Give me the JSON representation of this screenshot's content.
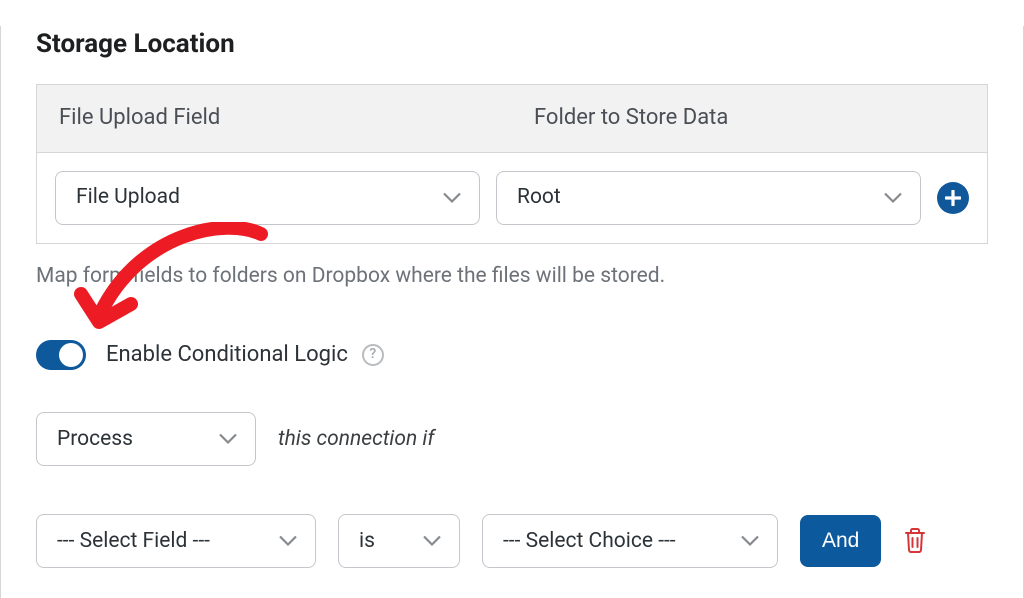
{
  "section_title": "Storage Location",
  "map_table": {
    "headers": {
      "field": "File Upload Field",
      "folder": "Folder to Store Data"
    },
    "row": {
      "field_value": "File Upload",
      "folder_value": "Root"
    }
  },
  "help_text": "Map form fields to folders on Dropbox where the files will be stored.",
  "conditional": {
    "toggle_label": "Enable Conditional Logic",
    "action_value": "Process",
    "sentence_suffix": "this connection if",
    "rule": {
      "field_value": "--- Select Field ---",
      "operator_value": "is",
      "choice_value": "--- Select Choice ---",
      "and_label": "And"
    }
  }
}
